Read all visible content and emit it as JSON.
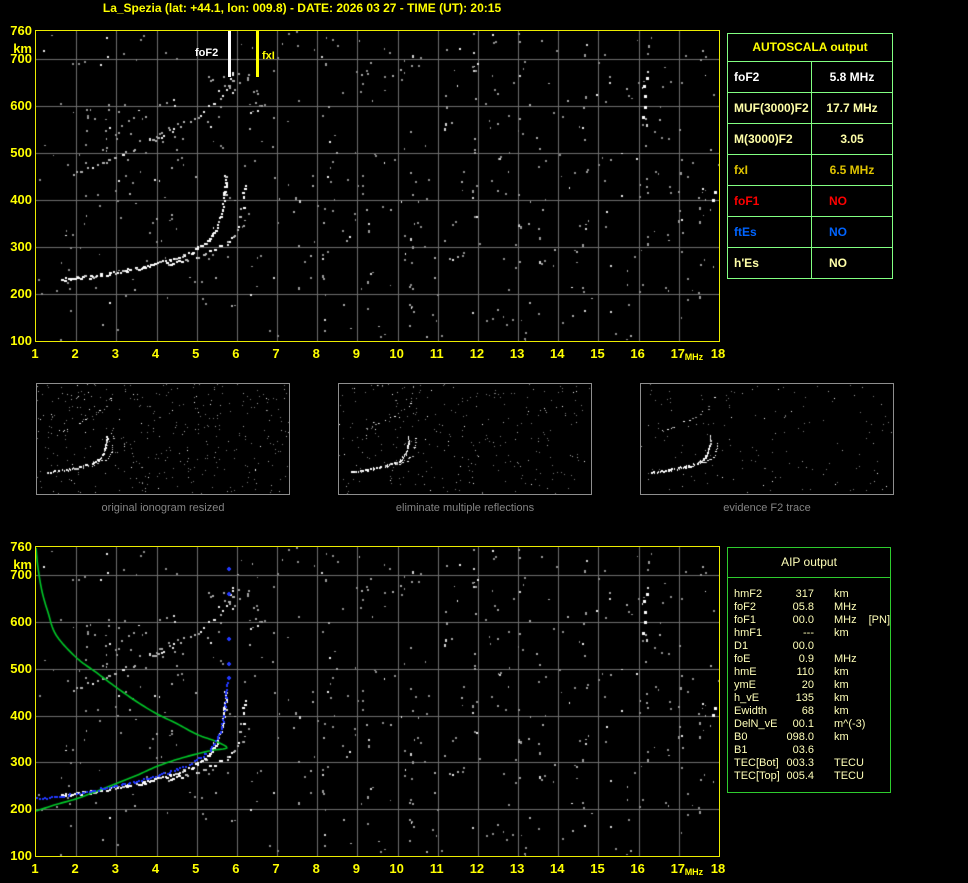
{
  "title": "La_Spezia (lat: +44.1, lon: 009.8) - DATE: 2026 03 27 - TIME (UT): 20:15",
  "colors": {
    "background": "#000000",
    "accent_yellow": "#FFFF00",
    "pale_yellow": "#FFFFA8",
    "gold": "#E0C400",
    "white": "#FFFFFF",
    "red": "#FF0000",
    "blue": "#0064FF",
    "table_border_light_green": "#82FF82",
    "table_border_green": "#2ECC2E",
    "grid_gray": "#6E6E6E",
    "model_green": "#00C828",
    "restored_blue": "#2238FF"
  },
  "axes": {
    "x_ticks": [
      1,
      2,
      3,
      4,
      5,
      6,
      7,
      8,
      9,
      10,
      11,
      12,
      13,
      14,
      15,
      16,
      17,
      18
    ],
    "x_unit": "MHz",
    "y_ticks": [
      760,
      700,
      600,
      500,
      400,
      300,
      200,
      100
    ],
    "y_unit": "km",
    "x_range": [
      1,
      18
    ],
    "y_range": [
      100,
      760
    ]
  },
  "markers": {
    "fof2": {
      "label": "foF2",
      "mhz": 5.8,
      "color": "#FFFFFF"
    },
    "fxi": {
      "label": "fxI",
      "mhz": 6.5,
      "color": "#FFFF00"
    }
  },
  "autoscala": {
    "title": "AUTOSCALA output",
    "rows": [
      {
        "label": "foF2",
        "value": "5.8 MHz",
        "color": "#FFFFFF",
        "no": false
      },
      {
        "label": "MUF(3000)F2",
        "value": "17.7 MHz",
        "color": "#FFFFA8",
        "no": false
      },
      {
        "label": "M(3000)F2",
        "value": "3.05",
        "color": "#FFFFA8",
        "no": false
      },
      {
        "label": "fxI",
        "value": "6.5 MHz",
        "color": "#E0C400",
        "no": false
      },
      {
        "label": "foF1",
        "value": "NO",
        "color": "#FF0000",
        "no": true
      },
      {
        "label": "ftEs",
        "value": "NO",
        "color": "#0064FF",
        "no": true
      },
      {
        "label": "h'Es",
        "value": "NO",
        "color": "#FFFFA8",
        "no": true
      }
    ]
  },
  "thumbnails": [
    {
      "caption": "original ionogram resized"
    },
    {
      "caption": "eliminate multiple reflections"
    },
    {
      "caption": "evidence F2 trace"
    }
  ],
  "aip": {
    "title": "AIP output",
    "rows": [
      {
        "label": "hmF2",
        "value": "317",
        "unit": "km",
        "extra": ""
      },
      {
        "label": "foF2",
        "value": "05.8",
        "unit": "MHz",
        "extra": ""
      },
      {
        "label": "foF1",
        "value": "00.0",
        "unit": "MHz",
        "extra": "[PN]"
      },
      {
        "label": "hmF1",
        "value": "---",
        "unit": "km",
        "extra": ""
      },
      {
        "label": "D1",
        "value": "00.0",
        "unit": "",
        "extra": ""
      },
      {
        "label": "foE",
        "value": "0.9",
        "unit": "MHz",
        "extra": ""
      },
      {
        "label": "hmE",
        "value": "110",
        "unit": "km",
        "extra": ""
      },
      {
        "label": "ymE",
        "value": "20",
        "unit": "km",
        "extra": ""
      },
      {
        "label": "h_vE",
        "value": "135",
        "unit": "km",
        "extra": ""
      },
      {
        "label": "Ewidth",
        "value": "68",
        "unit": "km",
        "extra": ""
      },
      {
        "label": "DelN_vE",
        "value": "00.1",
        "unit": "m^(-3)",
        "extra": ""
      },
      {
        "label": "B0",
        "value": "098.0",
        "unit": "km",
        "extra": ""
      },
      {
        "label": "B1",
        "value": "03.6",
        "unit": "",
        "extra": ""
      },
      {
        "label": "TEC[Bot]",
        "value": "003.3",
        "unit": "TECU",
        "extra": ""
      },
      {
        "label": "TEC[Top]",
        "value": "005.4",
        "unit": "TECU",
        "extra": ""
      }
    ]
  },
  "chart_data": {
    "type": "scatter",
    "title": "ionogram echo traces (virtual height km vs frequency MHz)",
    "x_unit": "MHz",
    "y_unit": "km",
    "x_range": [
      1,
      18
    ],
    "y_range": [
      100,
      760
    ],
    "scaled_values": {
      "foF2_MHz": 5.8,
      "fxI_MHz": 6.5,
      "MUF3000F2_MHz": 17.7,
      "M3000F2": 3.05,
      "hmF2_km": 317
    },
    "traces": {
      "f2_ordinary": [
        [
          1.65,
          231
        ],
        [
          2.0,
          234
        ],
        [
          2.4,
          238
        ],
        [
          2.8,
          243
        ],
        [
          3.2,
          249
        ],
        [
          3.6,
          256
        ],
        [
          4.0,
          264
        ],
        [
          4.4,
          274
        ],
        [
          4.8,
          287
        ],
        [
          5.0,
          296
        ],
        [
          5.2,
          308
        ],
        [
          5.35,
          322
        ],
        [
          5.5,
          342
        ],
        [
          5.6,
          368
        ],
        [
          5.66,
          395
        ],
        [
          5.7,
          425
        ],
        [
          5.72,
          452
        ]
      ],
      "f2_extraordinary": [
        [
          4.3,
          263
        ],
        [
          4.7,
          272
        ],
        [
          5.1,
          283
        ],
        [
          5.5,
          298
        ],
        [
          5.8,
          315
        ],
        [
          6.0,
          335
        ],
        [
          6.08,
          358
        ],
        [
          6.13,
          385
        ],
        [
          6.16,
          410
        ],
        [
          6.18,
          428
        ]
      ],
      "second_reflection": [
        [
          1.9,
          457
        ],
        [
          2.2,
          464
        ],
        [
          2.6,
          476
        ],
        [
          3.0,
          491
        ],
        [
          3.4,
          506
        ],
        [
          3.8,
          523
        ],
        [
          4.2,
          541
        ],
        [
          4.6,
          559
        ],
        [
          5.0,
          580
        ],
        [
          5.4,
          604
        ],
        [
          5.7,
          629
        ],
        [
          5.85,
          652
        ],
        [
          5.95,
          678
        ]
      ],
      "model_profile_green": [
        [
          1.0,
          196
        ],
        [
          1.5,
          210
        ],
        [
          2.0,
          222
        ],
        [
          2.5,
          238
        ],
        [
          3.0,
          255
        ],
        [
          3.5,
          272
        ],
        [
          4.0,
          291
        ],
        [
          4.5,
          306
        ],
        [
          5.0,
          318
        ],
        [
          5.4,
          326
        ],
        [
          5.75,
          331
        ],
        [
          5.5,
          344
        ],
        [
          5.0,
          360
        ],
        [
          4.5,
          383
        ],
        [
          4.0,
          404
        ],
        [
          3.5,
          430
        ],
        [
          3.0,
          460
        ],
        [
          2.5,
          492
        ],
        [
          2.0,
          524
        ],
        [
          1.5,
          572
        ],
        [
          1.3,
          620
        ],
        [
          1.15,
          665
        ],
        [
          1.05,
          715
        ],
        [
          1.0,
          758
        ]
      ],
      "restored_trace_blue": [
        [
          1.0,
          219
        ],
        [
          1.4,
          221
        ],
        [
          1.8,
          226
        ],
        [
          2.2,
          232
        ],
        [
          2.6,
          239
        ],
        [
          3.0,
          246
        ],
        [
          3.4,
          254
        ],
        [
          3.8,
          262
        ],
        [
          4.2,
          272
        ],
        [
          4.6,
          284
        ],
        [
          4.9,
          296
        ],
        [
          5.15,
          310
        ],
        [
          5.35,
          326
        ],
        [
          5.5,
          345
        ],
        [
          5.6,
          368
        ],
        [
          5.66,
          393
        ],
        [
          5.7,
          420
        ],
        [
          5.73,
          448
        ],
        [
          5.75,
          467
        ]
      ],
      "restored_spread_points": [
        [
          5.78,
          715
        ],
        [
          5.8,
          660
        ],
        [
          5.8,
          565
        ],
        [
          5.79,
          512
        ],
        [
          5.8,
          481
        ]
      ],
      "echo_clusters": [
        [
          16.1,
          578
        ],
        [
          16.15,
          600
        ],
        [
          16.15,
          622
        ],
        [
          16.12,
          645
        ],
        [
          16.2,
          660
        ],
        [
          17.85,
          402
        ],
        [
          17.88,
          418
        ]
      ]
    }
  }
}
